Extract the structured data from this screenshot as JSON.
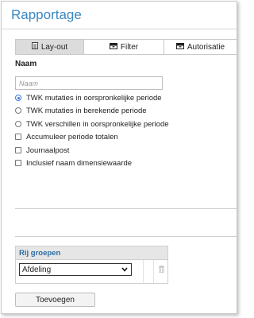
{
  "title": "Rapportage",
  "tabs": [
    {
      "label": "Lay-out",
      "icon": "document-icon",
      "active": true
    },
    {
      "label": "Filter",
      "icon": "tray-icon",
      "active": false
    },
    {
      "label": "Autorisatie",
      "icon": "tray-icon",
      "active": false
    }
  ],
  "section": {
    "label": "Naam"
  },
  "name_field": {
    "placeholder": "Naam",
    "value": ""
  },
  "radio_options": [
    {
      "label": "TWK mutaties in oorspronkelijke periode",
      "checked": true
    },
    {
      "label": "TWK mutaties in berekende periode",
      "checked": false
    },
    {
      "label": "TWK verschillen in oorspronkelijke periode",
      "checked": false
    }
  ],
  "checkbox_options": [
    {
      "label": "Accumuleer periode totalen",
      "checked": false
    },
    {
      "label": "Journaalpost",
      "checked": false
    },
    {
      "label": "Inclusief naam dimensiewaarde",
      "checked": false
    }
  ],
  "group_table": {
    "header": "Rij groepen",
    "rows": [
      {
        "select_value": "Afdeling"
      }
    ]
  },
  "add_button": {
    "label": "Toevoegen"
  },
  "colors": {
    "accent": "#3a87c2",
    "header_text": "#2c6ea5",
    "active_tab": "#dcdcdc"
  }
}
